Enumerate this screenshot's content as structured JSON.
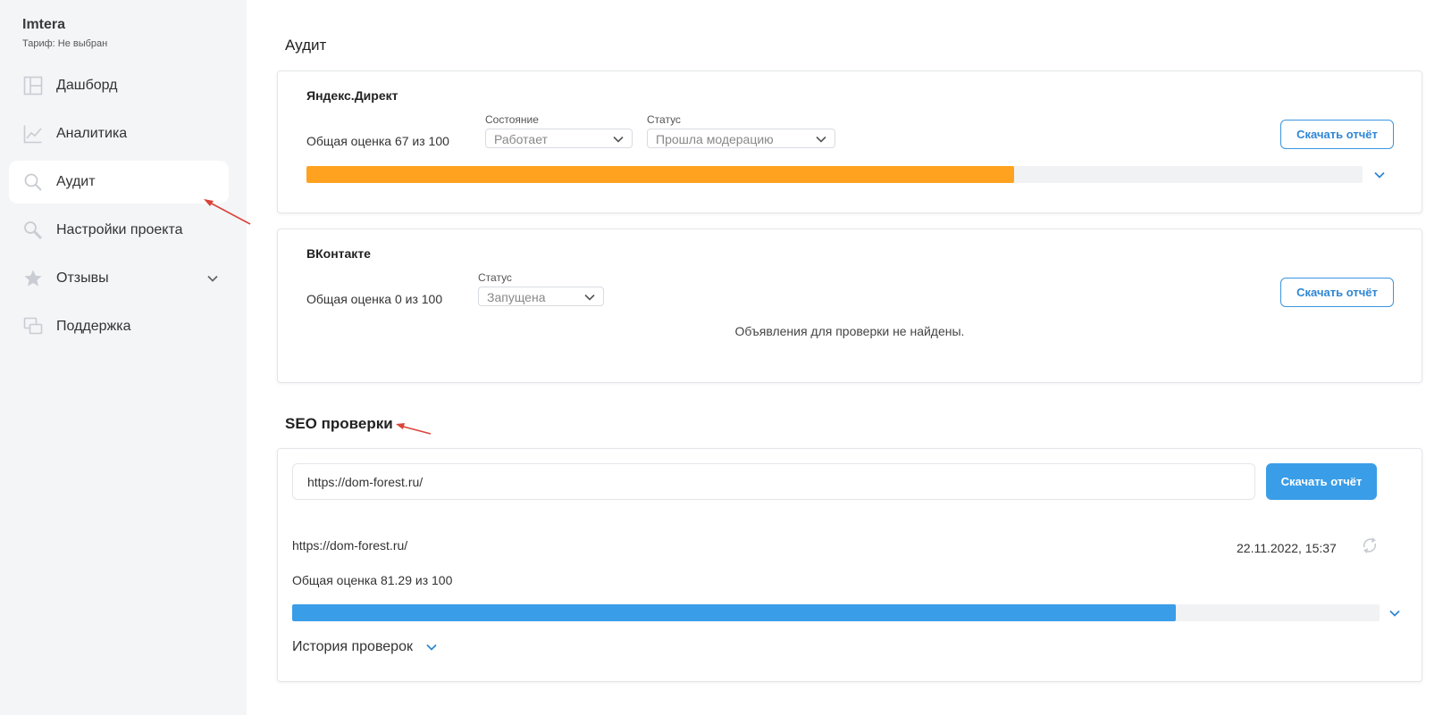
{
  "sidebar": {
    "brand": "Imtera",
    "plan": "Тариф: Не выбран",
    "items": [
      {
        "label": "Дашборд",
        "icon": "dashboard-icon"
      },
      {
        "label": "Аналитика",
        "icon": "chart-line-icon"
      },
      {
        "label": "Аудит",
        "icon": "search-icon",
        "active": true
      },
      {
        "label": "Настройки проекта",
        "icon": "wrench-icon"
      },
      {
        "label": "Отзывы",
        "icon": "star-icon",
        "has_submenu": true
      },
      {
        "label": "Поддержка",
        "icon": "chat-icon"
      }
    ]
  },
  "audit": {
    "title": "Аудит",
    "yandex": {
      "title": "Яндекс.Директ",
      "score_text": "Общая оценка 67 из 100",
      "score": 67,
      "state_label": "Состояние",
      "state_value": "Работает",
      "status_label": "Статус",
      "status_value": "Прошла модерацию",
      "download_label": "Скачать отчёт"
    },
    "vk": {
      "title": "ВКонтакте",
      "score_text": "Общая оценка 0 из 100",
      "score": 0,
      "status_label": "Статус",
      "status_value": "Запущена",
      "download_label": "Скачать отчёт",
      "empty_message": "Объявления для проверки не найдены."
    }
  },
  "seo": {
    "title": "SEO проверки",
    "url_input_value": "https://dom-forest.ru/",
    "download_label": "Скачать отчёт",
    "result_url": "https://dom-forest.ru/",
    "timestamp": "22.11.2022, 15:37",
    "score_text": "Общая оценка 81.29 из 100",
    "score": 81.29,
    "history_label": "История проверок"
  },
  "colors": {
    "orange": "#ffa21f",
    "blue": "#3a9de8",
    "annotation_red": "#d9433a"
  }
}
